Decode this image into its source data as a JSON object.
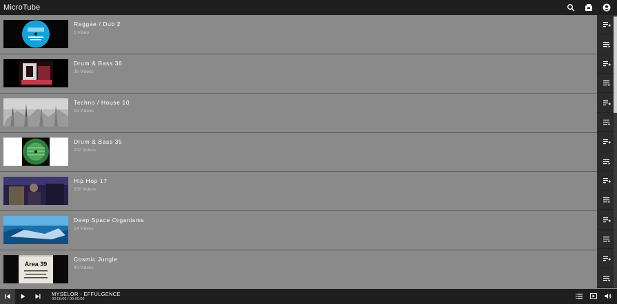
{
  "app": {
    "title": "MicroTube"
  },
  "header": {
    "icons": [
      "search-icon",
      "media-library-icon",
      "account-icon"
    ]
  },
  "playlists": [
    {
      "title": "Reggae / Dub 2",
      "count": "1 Video",
      "thumb": "blue-record-label"
    },
    {
      "title": "Drum & Bass 36",
      "count": "36 Videos",
      "thumb": "dark-red-art"
    },
    {
      "title": "Techno / House 10",
      "count": "18 Videos",
      "thumb": "foggy-trees"
    },
    {
      "title": "Drum & Bass 35",
      "count": "202 Videos",
      "thumb": "green-record-label"
    },
    {
      "title": "Hip Hop 17",
      "count": "206 Videos",
      "thumb": "purple-street-scene"
    },
    {
      "title": "Deep Space Organisms",
      "count": "14 Videos",
      "thumb": "blue-underwater"
    },
    {
      "title": "Cosmic Jungle",
      "count": "40 Videos",
      "thumb": "area-39-record-label",
      "thumb_text": "Area 39"
    }
  ],
  "player": {
    "now_playing": "MYSELOR - EFFULGENCE",
    "time": "00:00:00 / 00:00:00"
  },
  "colors": {
    "header": "#1f1f1f",
    "list_bg": "#8a8a8a",
    "side": "#2b2b2b"
  }
}
